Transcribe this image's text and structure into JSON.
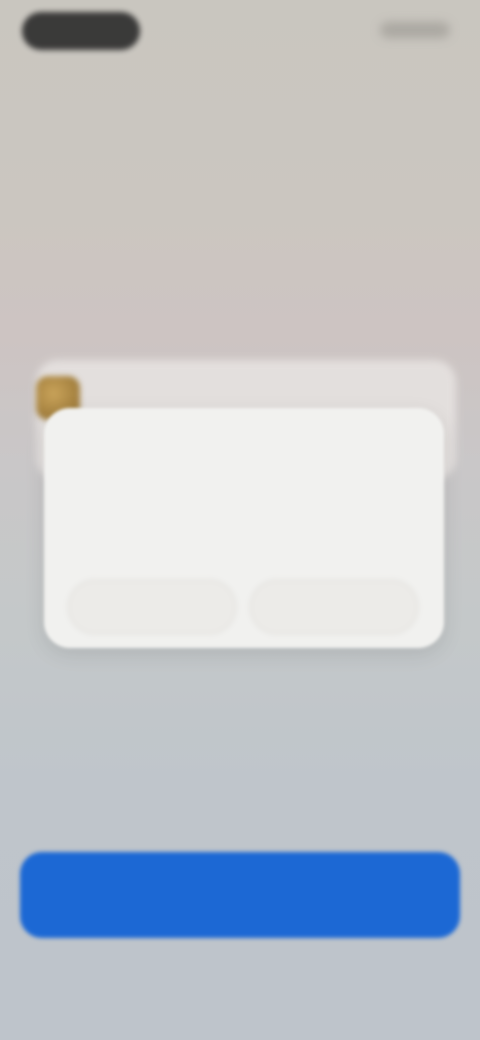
{
  "notification": {
    "app_name": "",
    "title": "",
    "subtitle": "",
    "left_button": "",
    "right_button": ""
  },
  "caption": "",
  "body_text": "",
  "primary_button": {
    "label": ""
  },
  "colors": {
    "accent": "#1c68d4",
    "app_name": "#b0396a",
    "card": "#f1f1ef"
  },
  "icons": {
    "app_icon": "app-icon"
  }
}
